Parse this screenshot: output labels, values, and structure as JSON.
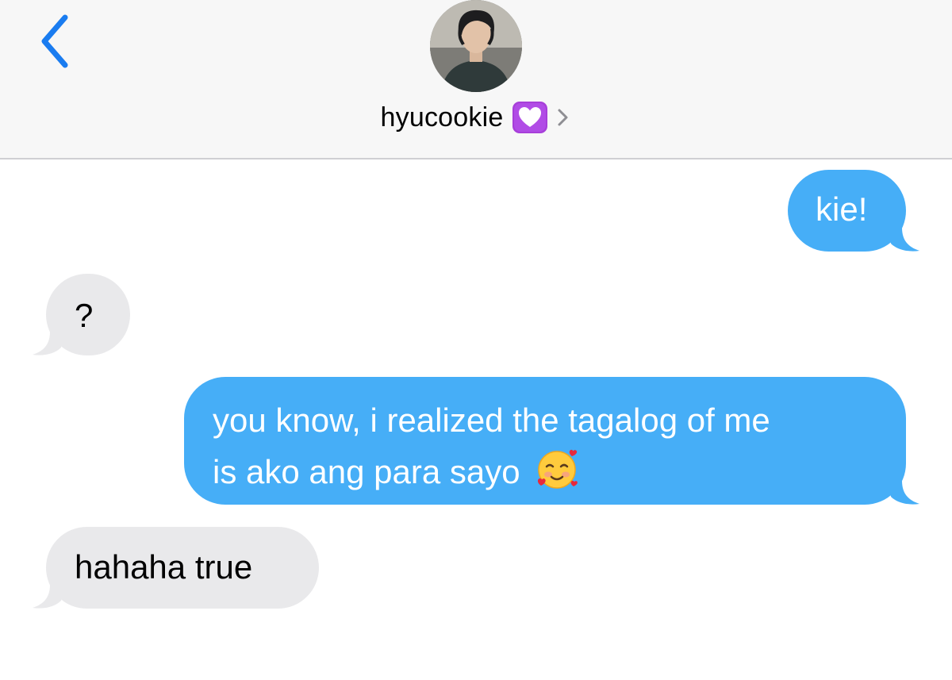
{
  "header": {
    "contact_name": "hyucookie"
  },
  "messages": [
    {
      "direction": "sent",
      "lines": [
        "kie!"
      ]
    },
    {
      "direction": "received",
      "lines": [
        "?"
      ]
    },
    {
      "direction": "sent",
      "lines": [
        "you know, i realized the tagalog of me",
        "is ako ang para sayo"
      ],
      "emoji": "smiling-face-with-hearts"
    },
    {
      "direction": "received",
      "lines": [
        "hahaha true"
      ]
    }
  ],
  "colors": {
    "sent_bubble": "#46aef7",
    "received_bubble": "#e9e9eb",
    "accent": "#1a7cf0",
    "heart_badge": "#a73fd9"
  }
}
